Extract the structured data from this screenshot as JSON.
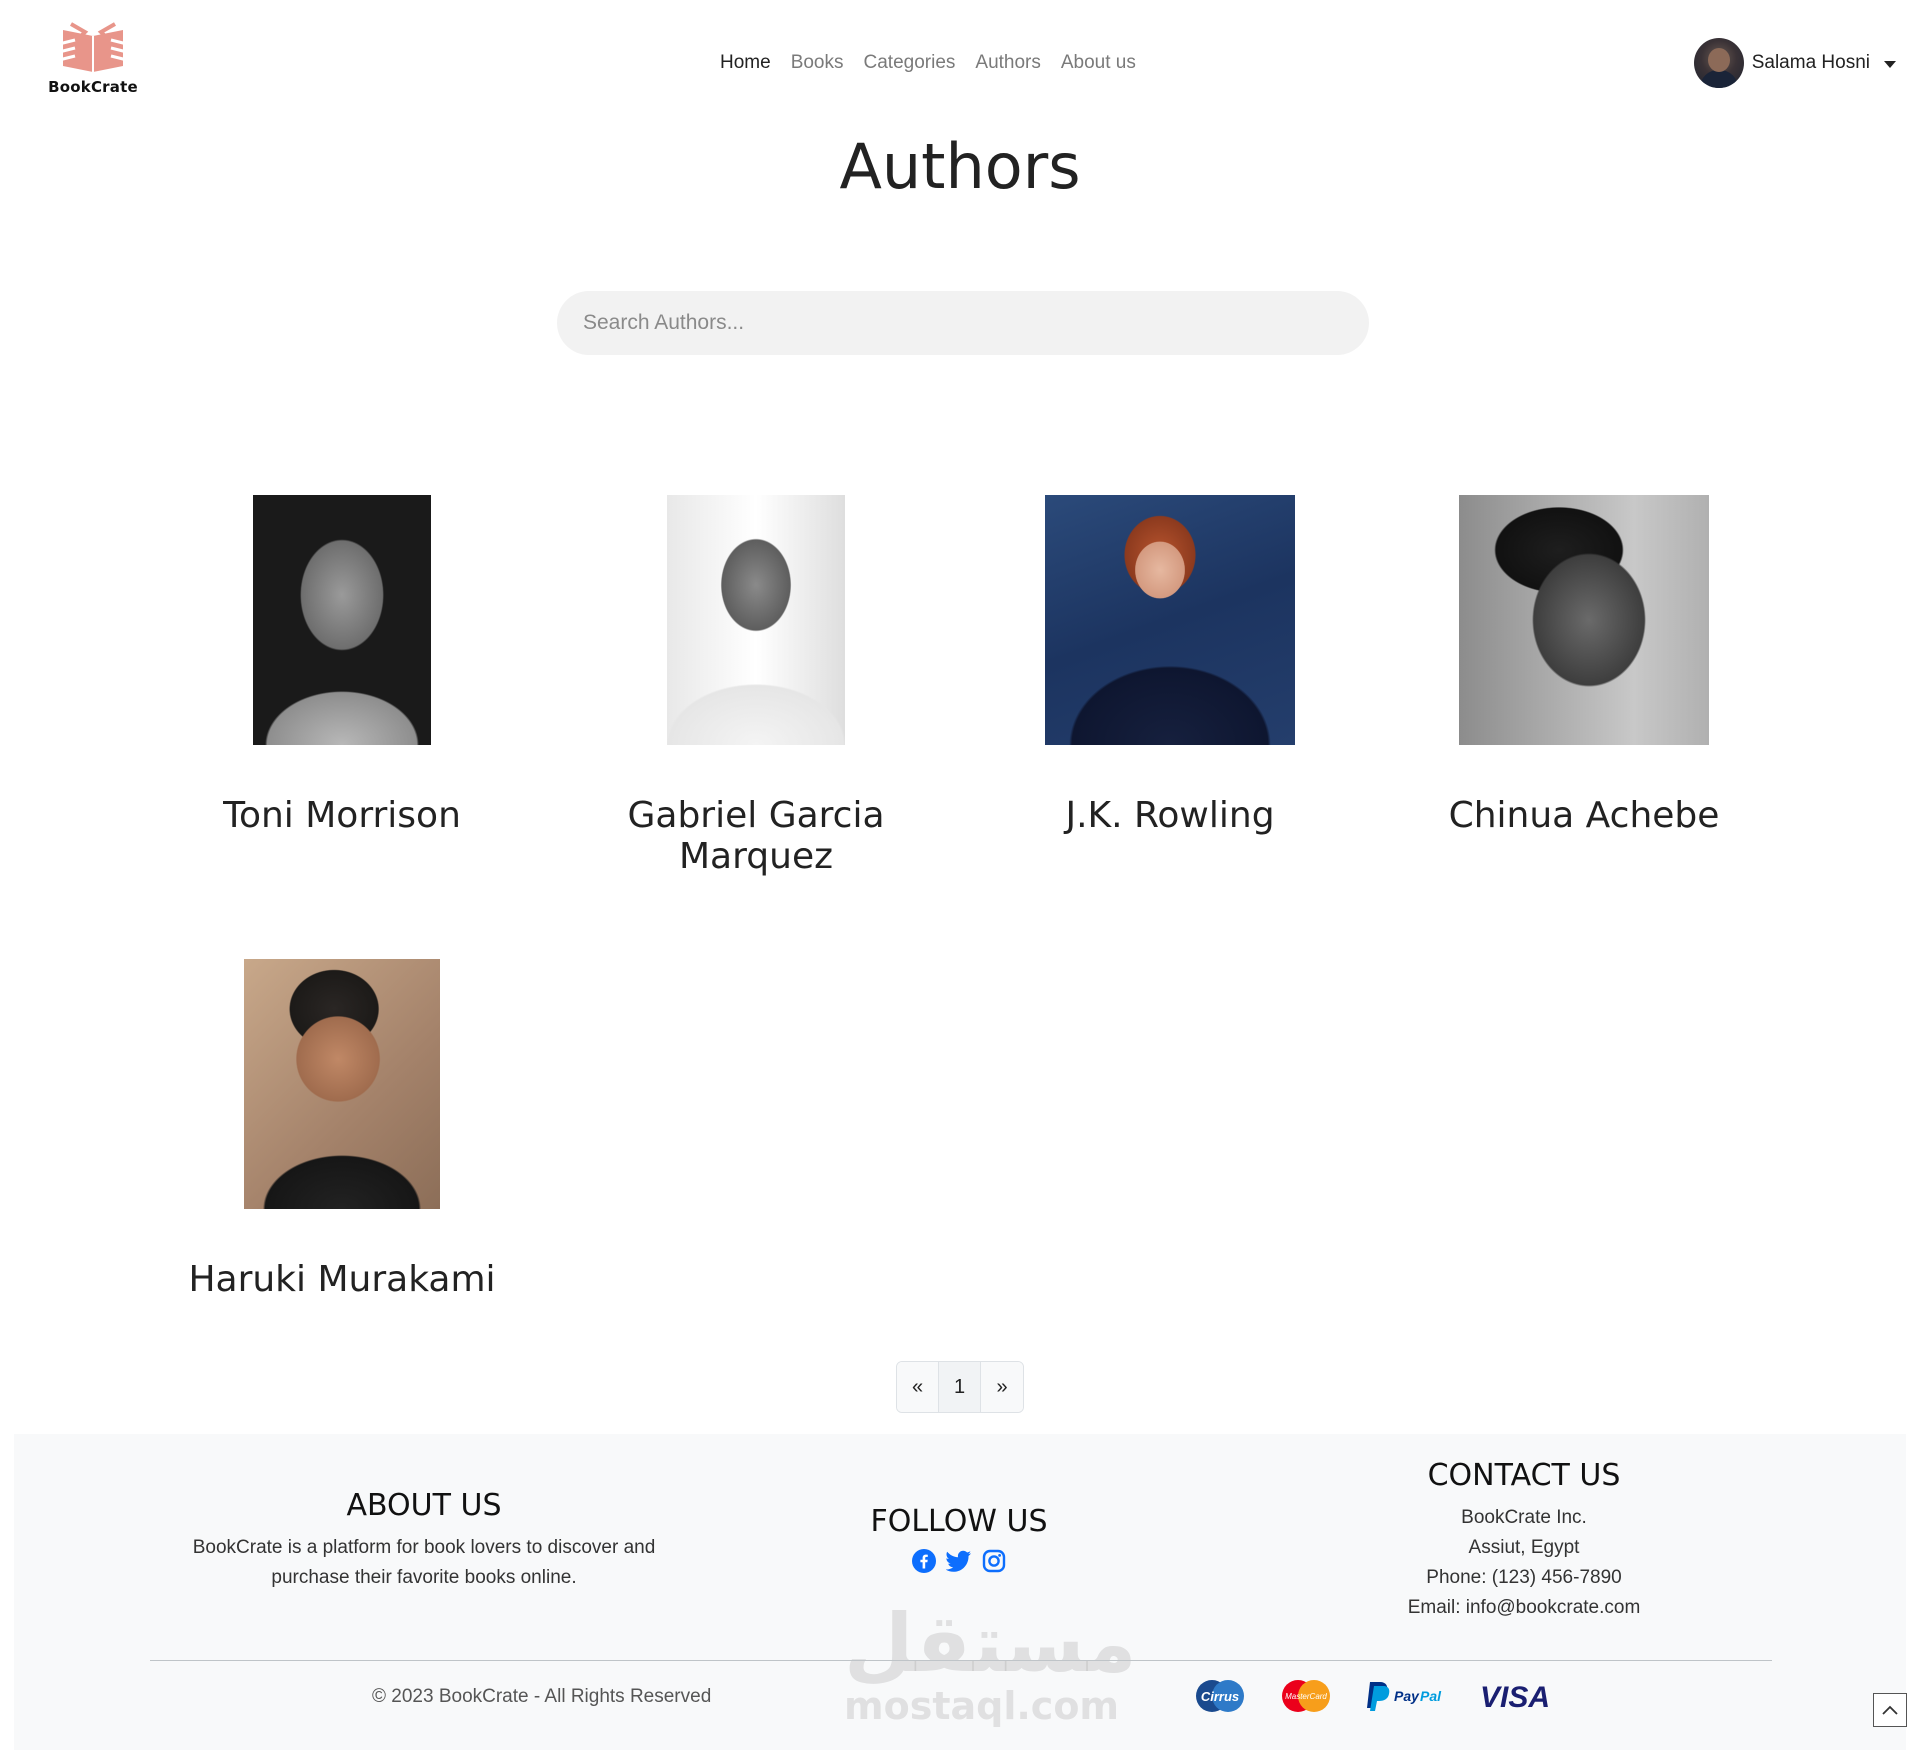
{
  "brand": {
    "name": "BookCrate",
    "logo_color": "#e8958a"
  },
  "nav": {
    "items": [
      {
        "label": "Home",
        "active": true
      },
      {
        "label": "Books"
      },
      {
        "label": "Categories"
      },
      {
        "label": "Authors"
      },
      {
        "label": "About us"
      }
    ]
  },
  "user": {
    "name": "Salama Hosni"
  },
  "page": {
    "title": "Authors"
  },
  "search": {
    "placeholder": "Search Authors...",
    "value": ""
  },
  "authors": [
    {
      "name": "Toni Morrison"
    },
    {
      "name": "Gabriel Garcia Marquez"
    },
    {
      "name": "J.K. Rowling"
    },
    {
      "name": "Chinua Achebe"
    },
    {
      "name": "Haruki Murakami"
    }
  ],
  "pagination": {
    "prev": "«",
    "current": "1",
    "next": "»"
  },
  "footer": {
    "about": {
      "heading": "ABOUT US",
      "line1": "BookCrate is a platform for book lovers to discover and",
      "line2": "purchase their favorite books online."
    },
    "follow": {
      "heading": "FOLLOW US",
      "icons": [
        "facebook-icon",
        "twitter-icon",
        "instagram-icon"
      ],
      "icon_color": "#0d6efd"
    },
    "contact": {
      "heading": "CONTACT US",
      "company": "BookCrate Inc.",
      "address": "Assiut, Egypt",
      "phone": "Phone: (123) 456-7890",
      "email": "Email: info@bookcrate.com"
    },
    "copyright": "© 2023 BookCrate - All Rights Reserved",
    "payments": [
      "cirrus-icon",
      "mastercard-icon",
      "paypal-icon",
      "visa-icon"
    ],
    "watermark": {
      "arabic": "مستقل",
      "latin": "mostaql.com"
    }
  }
}
